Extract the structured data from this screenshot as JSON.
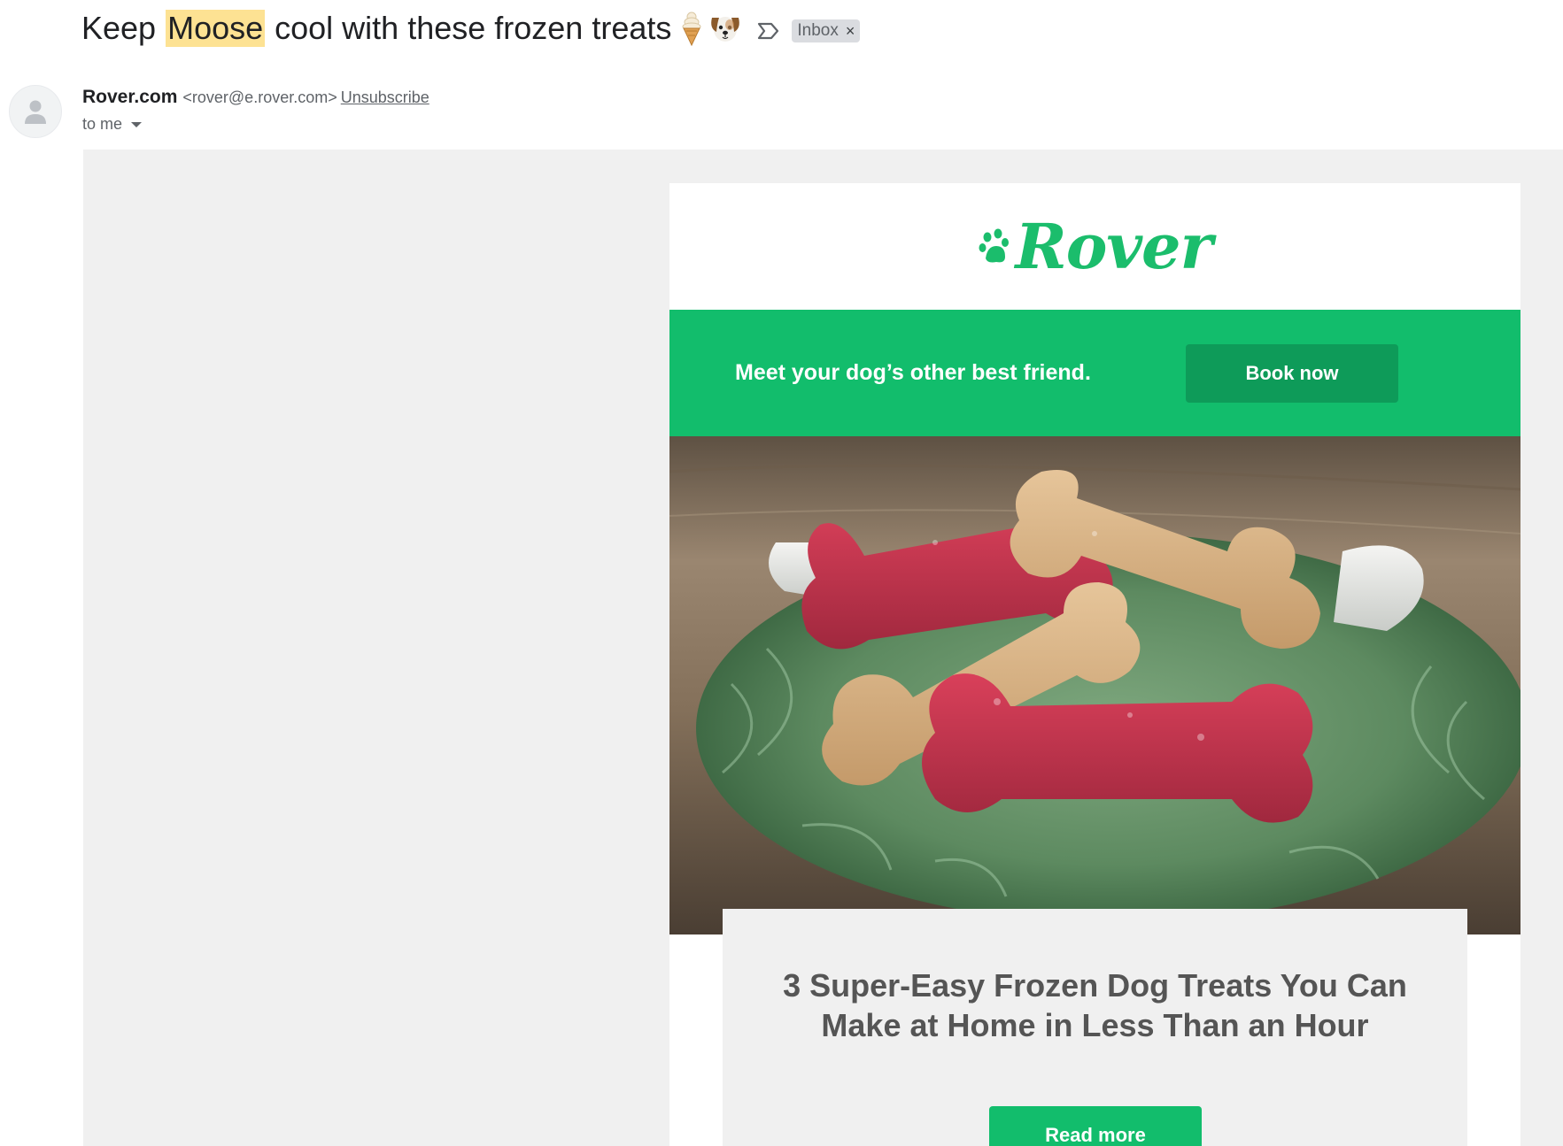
{
  "subject": {
    "before": "Keep ",
    "highlight": "Moose",
    "after": " cool with these frozen treats",
    "emoji_1": "🍦",
    "emoji_2": "🐶",
    "label_icon": "important-marker-icon",
    "label": "Inbox",
    "remove_label": "×"
  },
  "sender": {
    "name": "Rover.com",
    "email": "<rover@e.rover.com>",
    "unsubscribe": "Unsubscribe",
    "to": "to me",
    "avatar_icon": "person-icon"
  },
  "email": {
    "logo_text": "Rover",
    "logo_icon": "paw-icon",
    "brand_color": "#12bd6c",
    "banner_text": "Meet your dog’s other best friend.",
    "banner_button": "Book now",
    "hero_image": "frozen-dog-bone-treats-photo",
    "article_title_line1": "3 Super-Easy Frozen Dog Treats You Can",
    "article_title_line2": "Make at Home in Less Than an Hour",
    "article_button": "Read more"
  }
}
